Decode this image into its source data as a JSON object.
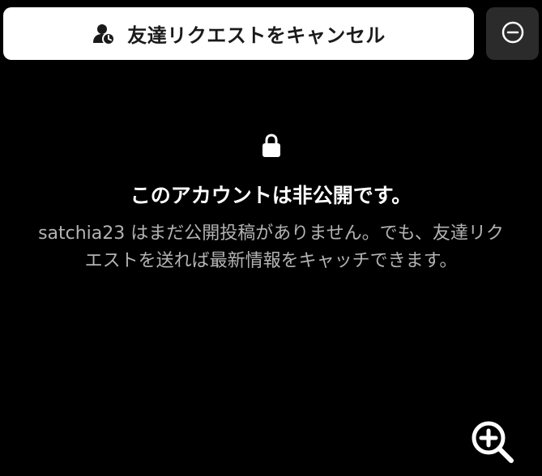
{
  "toolbar": {
    "cancel_request_label": "友達リクエストをキャンセル",
    "cancel_icon": "person-clock-icon",
    "more_icon": "minus-circle-icon"
  },
  "private_notice": {
    "lock_icon": "lock-icon",
    "title": "このアカウントは非公開です。",
    "description_line1": "satchia23 はまだ公開投稿がありません。でも、友達リク",
    "description_line2": "エストを送れば最新情報をキャッチできます。"
  },
  "zoom": {
    "icon": "zoom-in-icon"
  },
  "colors": {
    "background": "#000000",
    "button_bg": "#ffffff",
    "secondary_button_bg": "#2b2b2b",
    "description_text": "#b3b3b3"
  }
}
